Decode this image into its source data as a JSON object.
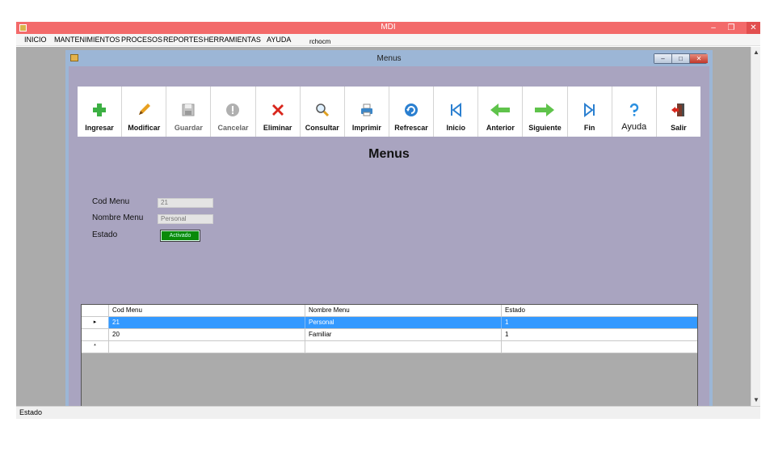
{
  "mdi": {
    "title": "MDI",
    "min_icon": "–",
    "max_icon": "❐",
    "close_icon": "✕"
  },
  "menu": {
    "items": [
      "INICIO",
      "MANTENIMIENTOS",
      "PROCESOS",
      "REPORTES",
      "HERRAMIENTAS",
      "AYUDA"
    ],
    "user": "rchocm"
  },
  "status": {
    "text": "Estado"
  },
  "child": {
    "title": "Menus",
    "min_icon": "–",
    "max_icon": "□",
    "close_icon": "✕"
  },
  "toolbar": {
    "buttons": [
      {
        "label": "Ingresar",
        "icon": "add-icon",
        "color": "#3cb043"
      },
      {
        "label": "Modificar",
        "icon": "pencil-icon",
        "color": "#e8a020"
      },
      {
        "label": "Guardar",
        "icon": "save-icon",
        "color": "#b8b8b8"
      },
      {
        "label": "Cancelar",
        "icon": "cancel-icon",
        "color": "#b0b0b0"
      },
      {
        "label": "Eliminar",
        "icon": "delete-icon",
        "color": "#d9261c"
      },
      {
        "label": "Consultar",
        "icon": "search-icon",
        "color": "#e0a020"
      },
      {
        "label": "Imprimir",
        "icon": "printer-icon",
        "color": "#3a86c8"
      },
      {
        "label": "Refrescar",
        "icon": "refresh-icon",
        "color": "#2a7fd0"
      },
      {
        "label": "Inicio",
        "icon": "first-icon",
        "color": "#2a7fd0"
      },
      {
        "label": "Anterior",
        "icon": "arrow-left-icon",
        "color": "#5fc34b"
      },
      {
        "label": "Siguiente",
        "icon": "arrow-right-icon",
        "color": "#5fc34b"
      },
      {
        "label": "Fin",
        "icon": "last-icon",
        "color": "#2a7fd0"
      },
      {
        "label": "Ayuda",
        "icon": "help-icon",
        "color": "#2a8fe0"
      },
      {
        "label": "Salir",
        "icon": "exit-icon",
        "color": "#c8201c"
      }
    ]
  },
  "form": {
    "title": "Menus",
    "cod_label": "Cod Menu",
    "cod_value": "21",
    "nombre_label": "Nombre Menu",
    "nombre_value": "Personal",
    "estado_label": "Estado",
    "estado_value": "Activado",
    "estado_color": "#0a8a0a"
  },
  "grid": {
    "columns": [
      "Cod Menu",
      "Nombre Menu",
      "Estado"
    ],
    "rows": [
      {
        "marker": "▸",
        "cells": [
          "21",
          "Personal",
          "1"
        ],
        "selected": true
      },
      {
        "marker": "",
        "cells": [
          "20",
          "Familiar",
          "1"
        ],
        "selected": false
      },
      {
        "marker": "*",
        "cells": [
          "",
          "",
          ""
        ],
        "selected": false
      }
    ],
    "selection_color": "#3399ff"
  },
  "scroll": {
    "up_icon": "▲",
    "down_icon": "▼"
  }
}
